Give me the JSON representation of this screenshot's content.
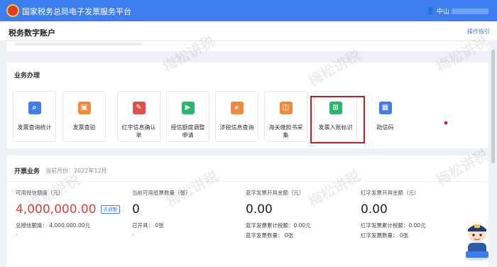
{
  "header": {
    "platform_title": "国家税务总局电子发票服务平台",
    "user_name": "中山"
  },
  "subheader": {
    "title": "税务数字账户",
    "guide_link": "操作指引"
  },
  "business": {
    "title": "业务办理",
    "tiles": [
      {
        "label": "发票查询统计",
        "icon": "invoice-stats-icon",
        "color": "#3f7de8"
      },
      {
        "label": "发票查验",
        "icon": "invoice-verify-icon",
        "color": "#f08a3c"
      },
      {
        "label": "红字信息确认单",
        "icon": "red-letter-confirm-icon",
        "color": "#e0504a"
      },
      {
        "label": "授信额度调整申请",
        "icon": "credit-adjust-icon",
        "color": "#29b46f"
      },
      {
        "label": "涉税信息查询",
        "icon": "tax-info-query-icon",
        "color": "#f08a3c"
      },
      {
        "label": "海关缴款书采集",
        "icon": "customs-collect-icon",
        "color": "#f08a3c"
      },
      {
        "label": "发票入账标识",
        "icon": "invoice-entry-mark-icon",
        "color": "#29b46f"
      },
      {
        "label": "助信码",
        "icon": "qr-code-icon",
        "color": "#3f7de8"
      }
    ]
  },
  "invoicing": {
    "title": "开票业务",
    "month": "当前月份：2022年12月",
    "credit_label": "可用授信额度（元）",
    "credit_value": "4,000,000.00",
    "adjust_label": "去调整",
    "total_credit": "总授信额度：  4,000,000.00元",
    "dash1": "-",
    "paper_label": "当前可用纸票数量（张）",
    "paper_value": "0",
    "issued": "已开具：   0张",
    "dash2": "-",
    "blue_label": "蓝字发票开具金额（元）",
    "blue_value": "0.00",
    "blue_tax": "蓝字发票累计税额：0.00元",
    "blue_count": "蓝字发票数量：   0张",
    "red_label": "红字发票开具金额（元）",
    "red_value": "0.00",
    "red_tax": "红字发票累计税额：0.00元",
    "red_count": "红字发票数量：   0张"
  },
  "watermark": "梅松讲税",
  "mascot": {
    "badge": "梅松讲税"
  },
  "colors": {
    "brand": "#3d7ef0",
    "highlight": "#c21f24",
    "credit": "#d8463e"
  }
}
